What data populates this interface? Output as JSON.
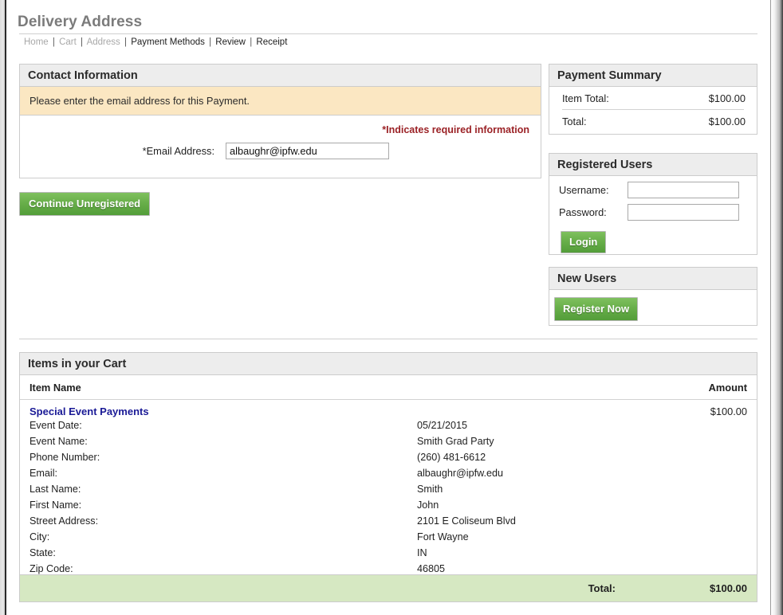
{
  "page": {
    "title": "Delivery Address"
  },
  "breadcrumb": {
    "items": [
      {
        "label": "Home",
        "state": "done"
      },
      {
        "label": "Cart",
        "state": "done"
      },
      {
        "label": "Address",
        "state": "done"
      },
      {
        "label": "Payment Methods",
        "state": "active"
      },
      {
        "label": "Review",
        "state": "active"
      },
      {
        "label": "Receipt",
        "state": "active"
      }
    ],
    "separator": "|"
  },
  "contact": {
    "heading": "Contact Information",
    "alert": "Please enter the email address for this Payment.",
    "required_note": "*Indicates required information",
    "email_label": "*Email Address:",
    "email_value": "albaughr@ipfw.edu",
    "email_placeholder": ""
  },
  "actions": {
    "continue_unregistered": "Continue Unregistered"
  },
  "payment_summary": {
    "heading": "Payment Summary",
    "rows": [
      {
        "label": "Item Total:",
        "value": "$100.00"
      },
      {
        "label": "Total:",
        "value": "$100.00"
      }
    ]
  },
  "registered_users": {
    "heading": "Registered Users",
    "username_label": "Username:",
    "username_value": "",
    "password_label": "Password:",
    "password_value": "",
    "login_label": "Login"
  },
  "new_users": {
    "heading": "New Users",
    "register_label": "Register Now"
  },
  "cart": {
    "heading": "Items in your Cart",
    "col_item": "Item Name",
    "col_amount": "Amount",
    "item_name": "Special Event Payments",
    "item_amount": "$100.00",
    "details": [
      {
        "label": "Event Date:",
        "value": "05/21/2015"
      },
      {
        "label": "Event Name:",
        "value": "Smith Grad Party"
      },
      {
        "label": "Phone Number:",
        "value": "(260) 481-6612"
      },
      {
        "label": "Email:",
        "value": "albaughr@ipfw.edu"
      },
      {
        "label": "Last Name:",
        "value": "Smith"
      },
      {
        "label": "First Name:",
        "value": "John"
      },
      {
        "label": "Street Address:",
        "value": "2101 E Coliseum Blvd"
      },
      {
        "label": "City:",
        "value": "Fort Wayne"
      },
      {
        "label": "State:",
        "value": "IN"
      },
      {
        "label": "Zip Code:",
        "value": "46805"
      }
    ],
    "total_label": "Total:",
    "total_value": "$100.00"
  },
  "colors": {
    "accent_green": "#67ae49",
    "alert_yellow": "#fbe7c2",
    "panel_header_grey": "#ededed",
    "required_red": "#9b2226",
    "link_blue": "#1a1a96",
    "total_green": "#d6e8c2"
  }
}
